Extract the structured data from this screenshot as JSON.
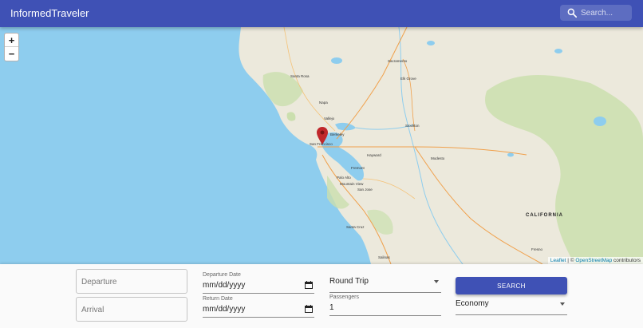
{
  "app": {
    "title": "InformedTraveler"
  },
  "search": {
    "placeholder": "Search..."
  },
  "map": {
    "zoom_in": "+",
    "zoom_out": "−",
    "attribution": {
      "leaflet": "Leaflet",
      "separator": " | © ",
      "osm": "OpenStreetMap",
      "suffix": " contributors"
    },
    "labels": {
      "sacramento": "Sacramento",
      "santa_rosa": "Santa Rosa",
      "napa": "Napa",
      "vallejo": "Vallejo",
      "berkeley": "Berkeley",
      "san_francisco": "San Francisco",
      "hayward": "Hayward",
      "fremont": "Fremont",
      "palo_alto": "Palo Alto",
      "mountain_view": "Mountain View",
      "san_jose": "San Jose",
      "stockton": "Stockton",
      "modesto": "Modesto",
      "elk_grove": "Elk Grove",
      "santa_cruz": "Santa Cruz",
      "salinas": "Salinas",
      "fresno": "Fresno",
      "california": "CALIFORNIA"
    },
    "colors": {
      "water": "#8ecdee",
      "land": "#ece9dc",
      "park": "#cbdfae",
      "highway": "#f0a04b",
      "marker": "#c0282c"
    }
  },
  "form": {
    "departure_placeholder": "Departure",
    "arrival_placeholder": "Arrival",
    "departure_date_label": "Departure Date",
    "departure_date_value": "mm/dd/yyyy",
    "return_date_label": "Return Date",
    "return_date_value": "mm/dd/yyyy",
    "trip_type": "Round Trip",
    "passengers_label": "Passengers",
    "passengers_value": "1",
    "search_button": "SEARCH",
    "cabin_class": "Economy"
  },
  "theme": {
    "primary": "#3f51b5"
  }
}
